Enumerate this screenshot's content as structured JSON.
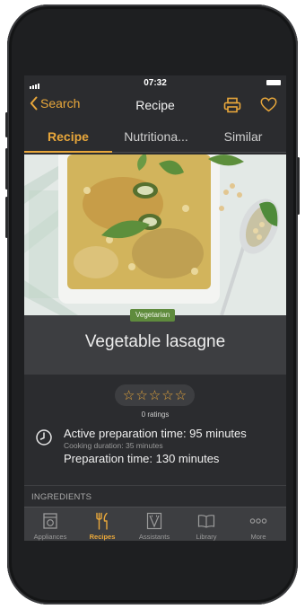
{
  "status": {
    "time": "07:32"
  },
  "nav": {
    "back_label": "Search",
    "title": "Recipe"
  },
  "tabs": [
    {
      "label": "Recipe",
      "active": true
    },
    {
      "label": "Nutritiona...",
      "active": false
    },
    {
      "label": "Similar",
      "active": false
    }
  ],
  "recipe": {
    "badge": "Vegetarian",
    "title": "Vegetable lasagne",
    "rating_stars": 0,
    "ratings_text": "0 ratings",
    "active_prep": "Active preparation time: 95 minutes",
    "cooking_duration": "Cooking duration: 35 minutes",
    "prep_time": "Preparation time: 130 minutes",
    "ingredients_heading": "INGREDIENTS"
  },
  "tabbar": [
    {
      "label": "Appliances",
      "icon": "oven-icon",
      "active": false
    },
    {
      "label": "Recipes",
      "icon": "cutlery-icon",
      "active": true
    },
    {
      "label": "Assistants",
      "icon": "assistant-icon",
      "active": false
    },
    {
      "label": "Library",
      "icon": "book-icon",
      "active": false
    },
    {
      "label": "More",
      "icon": "more-icon",
      "active": false
    }
  ],
  "colors": {
    "accent": "#e8a73b",
    "badge": "#5f8b3d",
    "background": "#2b2c2f",
    "band": "#3d3e41"
  }
}
